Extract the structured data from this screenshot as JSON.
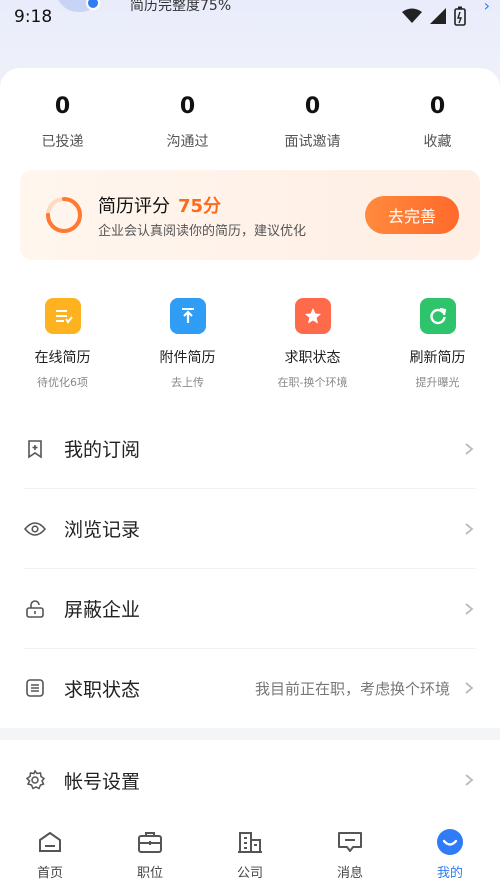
{
  "status_bar": {
    "time": "9:18",
    "notification_peek": "简历完整度75%"
  },
  "stats": [
    {
      "value": "0",
      "label": "已投递"
    },
    {
      "value": "0",
      "label": "沟通过"
    },
    {
      "value": "0",
      "label": "面试邀请"
    },
    {
      "value": "0",
      "label": "收藏"
    }
  ],
  "resume_score": {
    "title": "简历评分",
    "score": "75分",
    "score_fraction": 0.75,
    "subtitle": "企业会认真阅读你的简历，建议优化",
    "button": "去完善"
  },
  "quick_actions": [
    {
      "label": "在线简历",
      "sub": "待优化6项",
      "icon": "online-resume-icon"
    },
    {
      "label": "附件简历",
      "sub": "去上传",
      "icon": "attachment-resume-icon"
    },
    {
      "label": "求职状态",
      "sub": "在职-换个环境",
      "icon": "job-status-icon"
    },
    {
      "label": "刷新简历",
      "sub": "提升曝光",
      "icon": "refresh-resume-icon"
    }
  ],
  "menu": [
    {
      "label": "我的订阅",
      "value": "",
      "icon": "bookmark-icon"
    },
    {
      "label": "浏览记录",
      "value": "",
      "icon": "eye-icon"
    },
    {
      "label": "屏蔽企业",
      "value": "",
      "icon": "lock-icon"
    },
    {
      "label": "求职状态",
      "value": "我目前正在职，考虑换个环境",
      "icon": "document-icon"
    }
  ],
  "settings": {
    "label": "帐号设置",
    "icon": "gear-icon"
  },
  "tabs": [
    {
      "label": "首页",
      "icon": "home-icon"
    },
    {
      "label": "职位",
      "icon": "briefcase-icon"
    },
    {
      "label": "公司",
      "icon": "building-icon"
    },
    {
      "label": "消息",
      "icon": "message-icon"
    },
    {
      "label": "我的",
      "icon": "profile-icon",
      "active": true
    }
  ],
  "colors": {
    "accent": "#2f7cf6",
    "orange": "#ff6a1a"
  }
}
